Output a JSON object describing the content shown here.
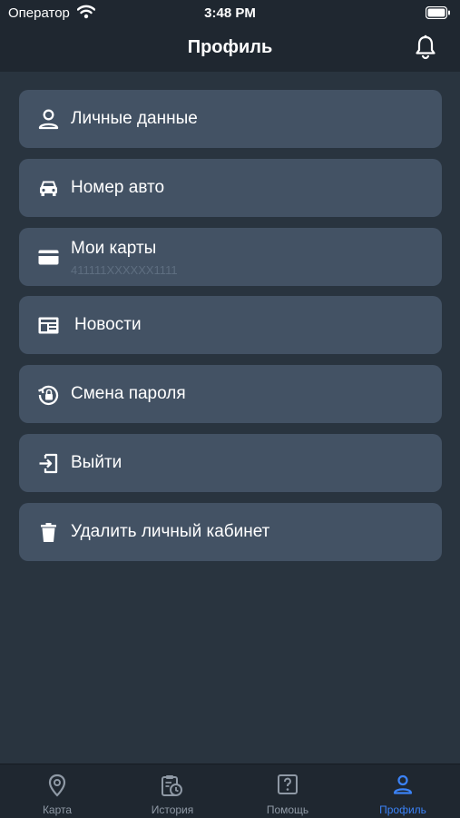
{
  "status_bar": {
    "carrier": "Оператор",
    "time": "3:48 PM"
  },
  "header": {
    "title": "Профиль"
  },
  "menu": [
    {
      "label": "Личные данные",
      "icon": "person-icon"
    },
    {
      "label": "Номер авто",
      "icon": "car-icon"
    },
    {
      "label": "Мои карты",
      "sub": "411111XXXXXX1111",
      "icon": "credit-card-icon"
    },
    {
      "label": "Новости",
      "icon": "newspaper-icon"
    },
    {
      "label": "Смена пароля",
      "icon": "lock-reset-icon"
    },
    {
      "label": "Выйти",
      "icon": "exit-icon"
    },
    {
      "label": "Удалить личный кабинет",
      "icon": "trash-icon"
    }
  ],
  "tabs": [
    {
      "label": "Карта",
      "icon": "map-pin-icon",
      "active": false
    },
    {
      "label": "История",
      "icon": "clipboard-history-icon",
      "active": false
    },
    {
      "label": "Помощь",
      "icon": "help-icon",
      "active": false
    },
    {
      "label": "Профиль",
      "icon": "user-icon",
      "active": true
    }
  ],
  "colors": {
    "background": "#28323e",
    "bar": "#1f2730",
    "card": "#435264",
    "subtext": "#5e6e80",
    "tab_inactive": "#8f99a5",
    "accent": "#3b82f6"
  }
}
